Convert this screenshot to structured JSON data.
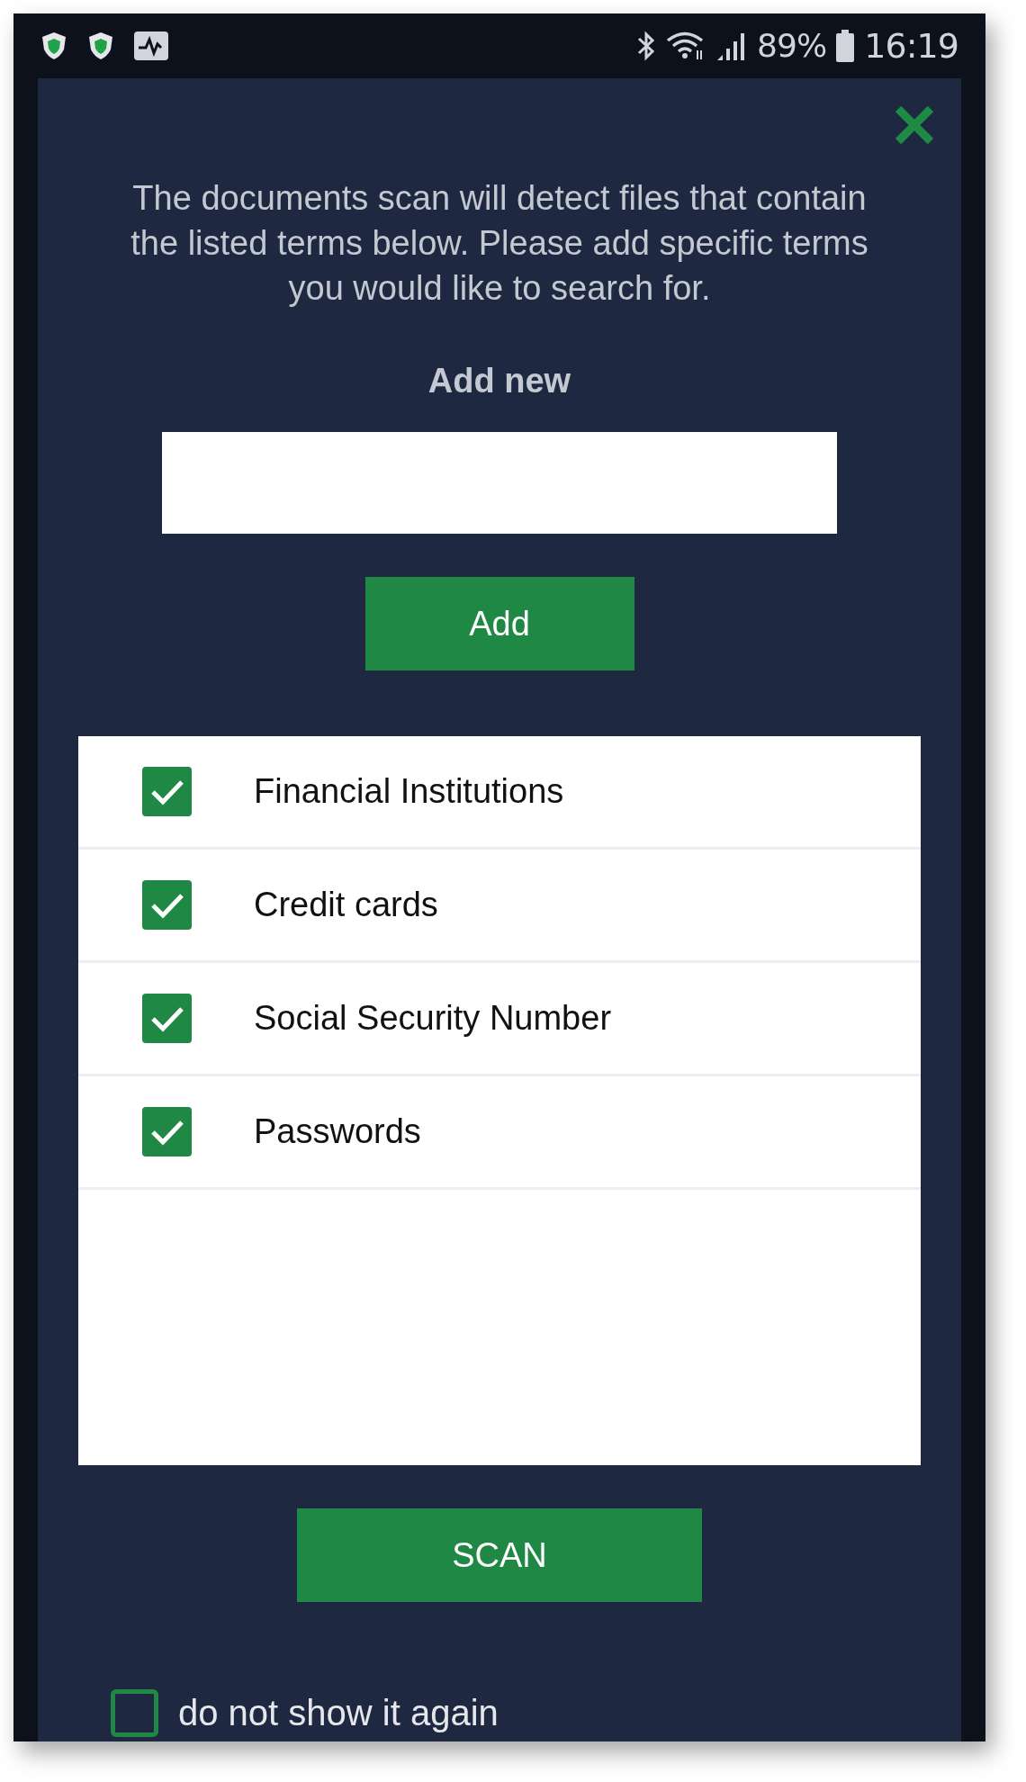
{
  "status_bar": {
    "battery": "89%",
    "time": "16:19"
  },
  "dialog": {
    "message": "The documents scan will detect files that contain the listed terms below. Please add specific terms you would like to search for.",
    "add_label": "Add new",
    "add_button": "Add",
    "terms": [
      {
        "label": "Financial Institutions",
        "checked": true
      },
      {
        "label": "Credit cards",
        "checked": true
      },
      {
        "label": "Social Security Number",
        "checked": true
      },
      {
        "label": "Passwords",
        "checked": true
      }
    ],
    "scan_button": "SCAN",
    "dont_show": {
      "label": "do not show it again",
      "checked": false
    }
  }
}
